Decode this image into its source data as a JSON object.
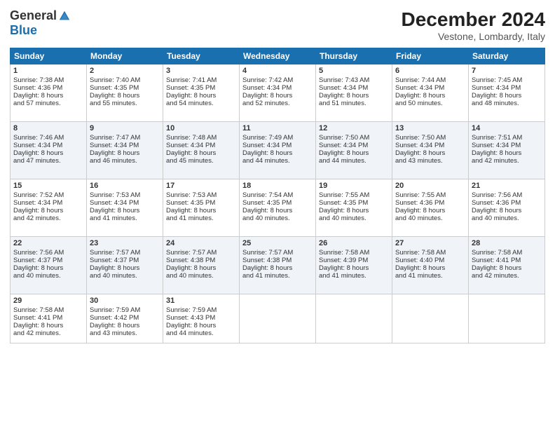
{
  "header": {
    "logo_general": "General",
    "logo_blue": "Blue",
    "title": "December 2024",
    "location": "Vestone, Lombardy, Italy"
  },
  "weekdays": [
    "Sunday",
    "Monday",
    "Tuesday",
    "Wednesday",
    "Thursday",
    "Friday",
    "Saturday"
  ],
  "weeks": [
    [
      {
        "day": 1,
        "sunrise": "7:38 AM",
        "sunset": "4:36 PM",
        "daylight": "8 hours and 57 minutes."
      },
      {
        "day": 2,
        "sunrise": "7:40 AM",
        "sunset": "4:35 PM",
        "daylight": "8 hours and 55 minutes."
      },
      {
        "day": 3,
        "sunrise": "7:41 AM",
        "sunset": "4:35 PM",
        "daylight": "8 hours and 54 minutes."
      },
      {
        "day": 4,
        "sunrise": "7:42 AM",
        "sunset": "4:34 PM",
        "daylight": "8 hours and 52 minutes."
      },
      {
        "day": 5,
        "sunrise": "7:43 AM",
        "sunset": "4:34 PM",
        "daylight": "8 hours and 51 minutes."
      },
      {
        "day": 6,
        "sunrise": "7:44 AM",
        "sunset": "4:34 PM",
        "daylight": "8 hours and 50 minutes."
      },
      {
        "day": 7,
        "sunrise": "7:45 AM",
        "sunset": "4:34 PM",
        "daylight": "8 hours and 48 minutes."
      }
    ],
    [
      {
        "day": 8,
        "sunrise": "7:46 AM",
        "sunset": "4:34 PM",
        "daylight": "8 hours and 47 minutes."
      },
      {
        "day": 9,
        "sunrise": "7:47 AM",
        "sunset": "4:34 PM",
        "daylight": "8 hours and 46 minutes."
      },
      {
        "day": 10,
        "sunrise": "7:48 AM",
        "sunset": "4:34 PM",
        "daylight": "8 hours and 45 minutes."
      },
      {
        "day": 11,
        "sunrise": "7:49 AM",
        "sunset": "4:34 PM",
        "daylight": "8 hours and 44 minutes."
      },
      {
        "day": 12,
        "sunrise": "7:50 AM",
        "sunset": "4:34 PM",
        "daylight": "8 hours and 44 minutes."
      },
      {
        "day": 13,
        "sunrise": "7:50 AM",
        "sunset": "4:34 PM",
        "daylight": "8 hours and 43 minutes."
      },
      {
        "day": 14,
        "sunrise": "7:51 AM",
        "sunset": "4:34 PM",
        "daylight": "8 hours and 42 minutes."
      }
    ],
    [
      {
        "day": 15,
        "sunrise": "7:52 AM",
        "sunset": "4:34 PM",
        "daylight": "8 hours and 42 minutes."
      },
      {
        "day": 16,
        "sunrise": "7:53 AM",
        "sunset": "4:34 PM",
        "daylight": "8 hours and 41 minutes."
      },
      {
        "day": 17,
        "sunrise": "7:53 AM",
        "sunset": "4:35 PM",
        "daylight": "8 hours and 41 minutes."
      },
      {
        "day": 18,
        "sunrise": "7:54 AM",
        "sunset": "4:35 PM",
        "daylight": "8 hours and 40 minutes."
      },
      {
        "day": 19,
        "sunrise": "7:55 AM",
        "sunset": "4:35 PM",
        "daylight": "8 hours and 40 minutes."
      },
      {
        "day": 20,
        "sunrise": "7:55 AM",
        "sunset": "4:36 PM",
        "daylight": "8 hours and 40 minutes."
      },
      {
        "day": 21,
        "sunrise": "7:56 AM",
        "sunset": "4:36 PM",
        "daylight": "8 hours and 40 minutes."
      }
    ],
    [
      {
        "day": 22,
        "sunrise": "7:56 AM",
        "sunset": "4:37 PM",
        "daylight": "8 hours and 40 minutes."
      },
      {
        "day": 23,
        "sunrise": "7:57 AM",
        "sunset": "4:37 PM",
        "daylight": "8 hours and 40 minutes."
      },
      {
        "day": 24,
        "sunrise": "7:57 AM",
        "sunset": "4:38 PM",
        "daylight": "8 hours and 40 minutes."
      },
      {
        "day": 25,
        "sunrise": "7:57 AM",
        "sunset": "4:38 PM",
        "daylight": "8 hours and 41 minutes."
      },
      {
        "day": 26,
        "sunrise": "7:58 AM",
        "sunset": "4:39 PM",
        "daylight": "8 hours and 41 minutes."
      },
      {
        "day": 27,
        "sunrise": "7:58 AM",
        "sunset": "4:40 PM",
        "daylight": "8 hours and 41 minutes."
      },
      {
        "day": 28,
        "sunrise": "7:58 AM",
        "sunset": "4:41 PM",
        "daylight": "8 hours and 42 minutes."
      }
    ],
    [
      {
        "day": 29,
        "sunrise": "7:58 AM",
        "sunset": "4:41 PM",
        "daylight": "8 hours and 42 minutes."
      },
      {
        "day": 30,
        "sunrise": "7:59 AM",
        "sunset": "4:42 PM",
        "daylight": "8 hours and 43 minutes."
      },
      {
        "day": 31,
        "sunrise": "7:59 AM",
        "sunset": "4:43 PM",
        "daylight": "8 hours and 44 minutes."
      },
      null,
      null,
      null,
      null
    ]
  ]
}
